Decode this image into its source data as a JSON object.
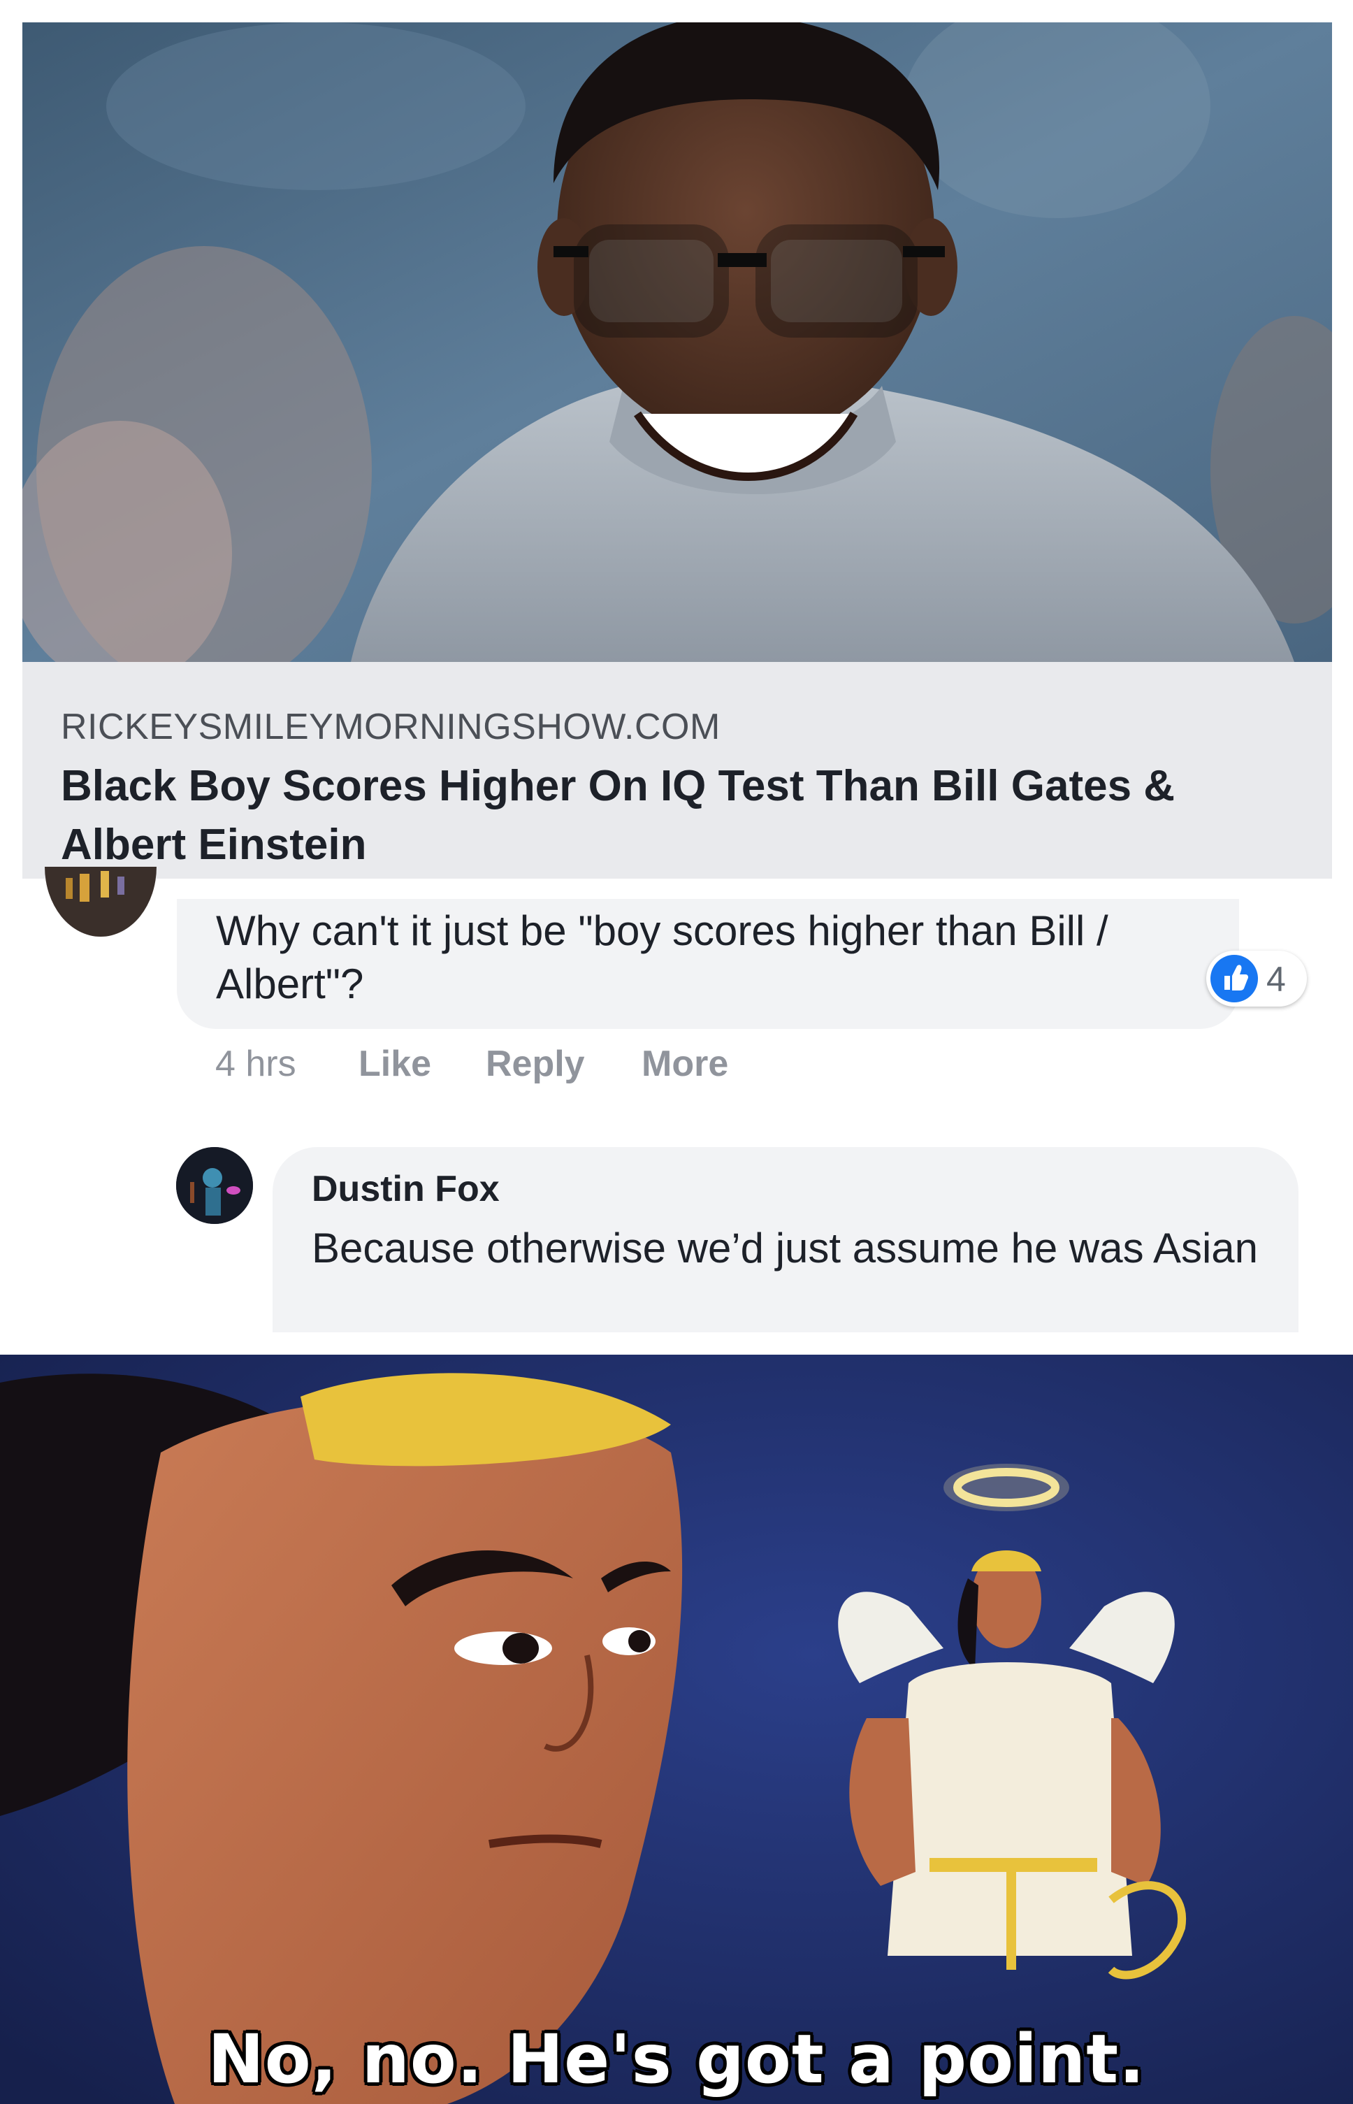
{
  "link_preview": {
    "domain": "RICKEYSMILEYMORNINGSHOW.COM",
    "title": "Black Boy Scores Higher On IQ Test Than Bill Gates & Albert Einstein"
  },
  "comment": {
    "text": "Why can't it just be \"boy scores higher than Bill / Albert\"?",
    "reaction_count": "4",
    "time": "4 hrs",
    "actions": {
      "like": "Like",
      "reply": "Reply",
      "more": "More"
    }
  },
  "reply": {
    "author": "Dustin Fox",
    "text": "Because otherwise we’d just assume he was Asian"
  },
  "meme": {
    "caption": "No, no. He's got a point."
  },
  "colors": {
    "link_meta_bg": "#e9eaed",
    "bubble_bg": "#f2f3f5",
    "action_text": "#90949c",
    "like_blue": "#1877f2",
    "meme_bg": "#1f2d6b"
  },
  "icons": [
    "like-reaction-icon"
  ]
}
